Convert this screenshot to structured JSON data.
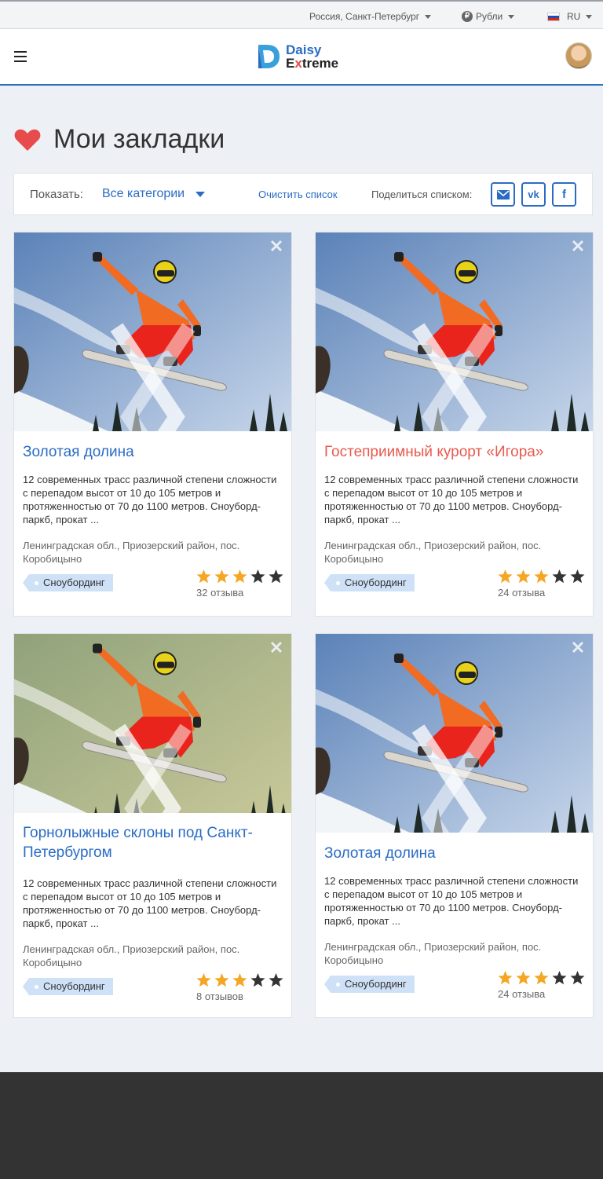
{
  "topbar": {
    "location": "Россия, Санкт-Петербург",
    "currency": "Рубли",
    "currency_icon": "rouble-icon",
    "language": "RU"
  },
  "header": {
    "logo_line1": "Daisy",
    "logo_line2_a": "E",
    "logo_line2_x": "x",
    "logo_line2_b": "treme"
  },
  "page": {
    "title": "Мои закладки"
  },
  "filter": {
    "show_label": "Показать:",
    "category_value": "Все категории",
    "clear_label": "Очистить список",
    "share_label": "Поделиться списком:",
    "share_buttons": [
      "mail-icon",
      "vk-icon",
      "facebook-icon"
    ]
  },
  "cards": [
    {
      "title": "Золотая долина",
      "title_color": "#2a6cc4",
      "description": "12 современных трасс различной степени сложности с перепадом высот от 10 до 105 метров и протяженностью от 70 до 1100 метров. Сноуборд-паркб, прокат ...",
      "location": "Ленинградская обл., Приозерский район, пос. Коробицыно",
      "tag": "Сноубординг",
      "rating": 3,
      "rating_max": 5,
      "reviews": "32 отзыва"
    },
    {
      "title": "Гостеприимный курорт «Игора»",
      "title_color": "#e85a4f",
      "description": "12 современных трасс различной степени сложности с перепадом высот от 10 до 105 метров и протяженностью от 70 до 1100 метров. Сноуборд-паркб, прокат ...",
      "location": "Ленинградская обл., Приозерский район, пос. Коробицыно",
      "tag": "Сноубординг",
      "rating": 3,
      "rating_max": 5,
      "reviews": "24 отзыва"
    },
    {
      "title": "Горнолыжные склоны под Санкт-Петербургом",
      "title_color": "#2a6cc4",
      "description": "12 современных трасс различной степени сложности с перепадом высот от 10 до 105 метров и протяженностью от 70 до 1100 метров. Сноуборд-паркб, прокат ...",
      "location": "Ленинградская обл., Приозерский район, пос. Коробицыно",
      "tag": "Сноубординг",
      "rating": 3,
      "rating_max": 5,
      "reviews": "8 отзывов"
    },
    {
      "title": "Золотая долина",
      "title_color": "#2a6cc4",
      "description": "12 современных трасс различной степени сложности с перепадом высот от 10 до 105 метров и протяженностью от 70 до 1100 метров. Сноуборд-паркб, прокат ...",
      "location": "Ленинградская обл., Приозерский район, пос. Коробицыно",
      "tag": "Сноубординг",
      "rating": 3,
      "rating_max": 5,
      "reviews": "24 отзыва"
    }
  ],
  "colors": {
    "accent": "#2a6cc4",
    "heart": "#e84b4b",
    "star_filled": "#f5a623",
    "star_empty": "#333333",
    "footer": "#333333"
  }
}
